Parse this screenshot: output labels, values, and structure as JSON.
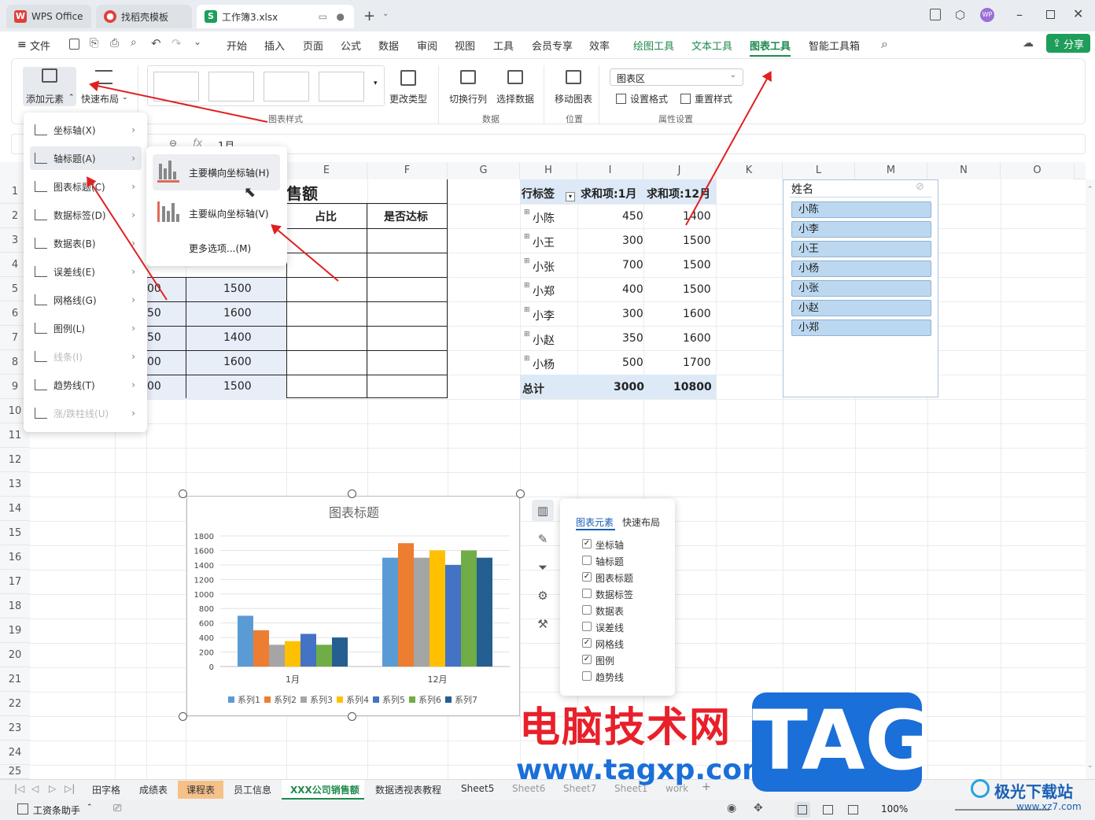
{
  "titlebar": {
    "tabs": [
      {
        "label": "WPS Office"
      },
      {
        "label": "找稻壳模板"
      },
      {
        "label": "工作簿3.xlsx"
      }
    ],
    "add_label": "+"
  },
  "menubar": {
    "file": "文件",
    "items": [
      "开始",
      "插入",
      "页面",
      "公式",
      "数据",
      "审阅",
      "视图",
      "工具",
      "会员专享",
      "效率",
      "绘图工具",
      "文本工具",
      "图表工具",
      "智能工具箱"
    ],
    "share": "分享"
  },
  "ribbon": {
    "add_element": "添加元素",
    "quick_layout": "快速布局",
    "chart_style_group": "图表样式",
    "change_type": "更改类型",
    "switch_rowcol": "切换行列",
    "select_data": "选择数据",
    "data_group": "数据",
    "move_chart": "移动图表",
    "position_group": "位置",
    "chart_area_select": "图表区",
    "set_format": "设置格式",
    "reset_style": "重置样式",
    "props_group": "属性设置"
  },
  "formula": {
    "fx": "fx",
    "value": "1月"
  },
  "columns": [
    "E",
    "F",
    "G",
    "H",
    "I",
    "J",
    "K",
    "L",
    "M",
    "N",
    "O"
  ],
  "rows": [
    "1",
    "2",
    "3",
    "4",
    "5",
    "6",
    "7",
    "8",
    "9",
    "10",
    "11",
    "12",
    "13",
    "14",
    "15",
    "16",
    "17",
    "18",
    "19",
    "20",
    "21",
    "22",
    "23",
    "24",
    "25"
  ],
  "table": {
    "title_partial": "售额",
    "header_e": "占比",
    "header_f": "是否达标",
    "col_a_partial": [
      "00",
      "50",
      "50",
      "00",
      "00"
    ],
    "col_b": [
      "1500",
      "1600",
      "1400",
      "1600",
      "1500"
    ]
  },
  "pivot": {
    "headers": [
      "行标签",
      "求和项:1月",
      "求和项:12月"
    ],
    "rows": [
      {
        "name": "小陈",
        "jan": "450",
        "dec": "1400"
      },
      {
        "name": "小王",
        "jan": "300",
        "dec": "1500"
      },
      {
        "name": "小张",
        "jan": "700",
        "dec": "1500"
      },
      {
        "name": "小郑",
        "jan": "400",
        "dec": "1500"
      },
      {
        "name": "小李",
        "jan": "300",
        "dec": "1600"
      },
      {
        "name": "小赵",
        "jan": "350",
        "dec": "1600"
      },
      {
        "name": "小杨",
        "jan": "500",
        "dec": "1700"
      }
    ],
    "total": {
      "name": "总计",
      "jan": "3000",
      "dec": "10800"
    }
  },
  "slicer": {
    "title": "姓名",
    "items": [
      "小陈",
      "小李",
      "小王",
      "小杨",
      "小张",
      "小赵",
      "小郑"
    ]
  },
  "dropdown": {
    "items": [
      {
        "label": "坐标轴(X)",
        "disabled": false
      },
      {
        "label": "轴标题(A)",
        "disabled": false
      },
      {
        "label": "图表标题(C)",
        "disabled": false
      },
      {
        "label": "数据标签(D)",
        "disabled": false
      },
      {
        "label": "数据表(B)",
        "disabled": false
      },
      {
        "label": "误差线(E)",
        "disabled": false
      },
      {
        "label": "网格线(G)",
        "disabled": false
      },
      {
        "label": "图例(L)",
        "disabled": false
      },
      {
        "label": "线条(I)",
        "disabled": true
      },
      {
        "label": "趋势线(T)",
        "disabled": false
      },
      {
        "label": "涨/跌柱线(U)",
        "disabled": true
      }
    ],
    "submenu": [
      "主要横向坐标轴(H)",
      "主要纵向坐标轴(V)",
      "更多选项...(M)"
    ]
  },
  "chart_data": {
    "type": "bar",
    "title": "图表标题",
    "categories": [
      "1月",
      "12月"
    ],
    "series": [
      {
        "name": "系列1",
        "values": [
          700,
          1500
        ],
        "color": "#5b9bd5"
      },
      {
        "name": "系列2",
        "values": [
          500,
          1700
        ],
        "color": "#ed7d31"
      },
      {
        "name": "系列3",
        "values": [
          300,
          1500
        ],
        "color": "#a5a5a5"
      },
      {
        "name": "系列4",
        "values": [
          350,
          1600
        ],
        "color": "#ffc000"
      },
      {
        "name": "系列5",
        "values": [
          450,
          1400
        ],
        "color": "#4472c4"
      },
      {
        "name": "系列6",
        "values": [
          300,
          1600
        ],
        "color": "#70ad47"
      },
      {
        "name": "系列7",
        "values": [
          400,
          1500
        ],
        "color": "#255e91"
      }
    ],
    "yticks": [
      "0",
      "200",
      "400",
      "600",
      "800",
      "1000",
      "1200",
      "1400",
      "1600",
      "1800"
    ],
    "ylim": [
      0,
      1800
    ],
    "grid": true,
    "legend": "bottom"
  },
  "chart_panel": {
    "tabs": [
      "图表元素",
      "快速布局"
    ],
    "items": [
      {
        "label": "坐标轴",
        "checked": true
      },
      {
        "label": "轴标题",
        "checked": false
      },
      {
        "label": "图表标题",
        "checked": true
      },
      {
        "label": "数据标签",
        "checked": false
      },
      {
        "label": "数据表",
        "checked": false
      },
      {
        "label": "误差线",
        "checked": false
      },
      {
        "label": "网格线",
        "checked": true
      },
      {
        "label": "图例",
        "checked": true
      },
      {
        "label": "趋势线",
        "checked": false
      }
    ]
  },
  "sheets": [
    "田字格",
    "成绩表",
    "课程表",
    "员工信息",
    "XXX公司销售额",
    "数据透视表教程",
    "Sheet5",
    "Sheet6",
    "Sheet7",
    "Sheet1",
    "work"
  ],
  "status": {
    "assistant": "工资条助手",
    "zoom": "100%"
  },
  "watermark": {
    "cn": "电脑技术网",
    "tag": "TAG",
    "url": "www.tagxp.com",
    "brand": "极光下载站",
    "brand_url": "www.xz7.com"
  },
  "colors": {
    "green": "#1e8a4e",
    "red_arrow": "#e02020",
    "selection": "#e8eef8"
  }
}
